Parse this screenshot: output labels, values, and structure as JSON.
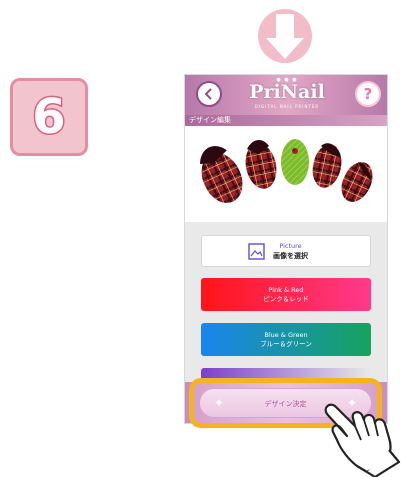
{
  "step": {
    "number": "6"
  },
  "header": {
    "logo": "PriNail",
    "logo_subtitle": "DIGITAL NAIL PRINTER",
    "help_glyph": "?"
  },
  "subheader": {
    "title": "デザイン編集"
  },
  "picture_button": {
    "label_en": "Picture",
    "label_jp": "画像を選択"
  },
  "buttons": [
    {
      "label_en": "Pink & Red",
      "label_jp": "ピンク＆レッド"
    },
    {
      "label_en": "Blue & Green",
      "label_jp": "ブルー＆グリーン"
    }
  ],
  "decide_button": {
    "label": "デザイン決定"
  },
  "icons": {
    "down": "down-arrow-icon",
    "back": "chevron-left-icon",
    "help": "question-icon",
    "picture": "image-icon",
    "hand": "pointing-hand-icon"
  },
  "colors": {
    "badge_bg": "#f2c4cd",
    "header": "#c98bc0",
    "pink_red": [
      "#ff1418",
      "#ff3a8c"
    ],
    "blue_green": [
      "#1a85f0",
      "#17a35e"
    ],
    "highlight": "#f4b321"
  }
}
